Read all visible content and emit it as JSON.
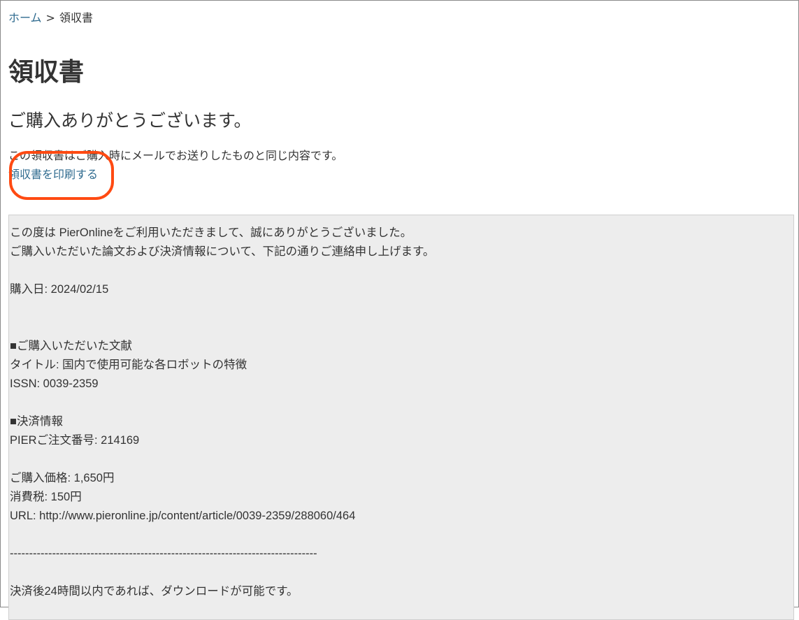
{
  "breadcrumb": {
    "home": "ホーム",
    "separator": ">",
    "current": "領収書"
  },
  "page": {
    "title": "領収書",
    "thanks": "ご購入ありがとうございます。",
    "note": "この領収書はご購入時にメールでお送りしたものと同じ内容です。",
    "print_link": "領収書を印刷する"
  },
  "receipt": {
    "greeting_1": "この度は PierOnlineをご利用いただきまして、誠にありがとうございました。",
    "greeting_2": "ご購入いただいた論文および決済情報について、下記の通りご連絡申し上げます。",
    "purchase_date": "購入日: 2024/02/15",
    "literature_header": "■ご購入いただいた文献",
    "title_line": "タイトル:  国内で使用可能な各ロボットの特徴",
    "issn_line": "ISSN: 0039-2359",
    "payment_header": "■決済情報",
    "order_number": "PIERご注文番号:  214169",
    "price": "ご購入価格:   1,650円",
    "tax": "消費税:  150円",
    "url": "URL: http://www.pieronline.jp/content/article/0039-2359/288060/464",
    "divider": "--------------------------------------------------------------------------------",
    "download_note": "決済後24時間以内であれば、ダウンロードが可能です。"
  },
  "colors": {
    "link": "#2f6b8f",
    "highlight": "#ff4a12",
    "receipt_background": "#ededed"
  }
}
